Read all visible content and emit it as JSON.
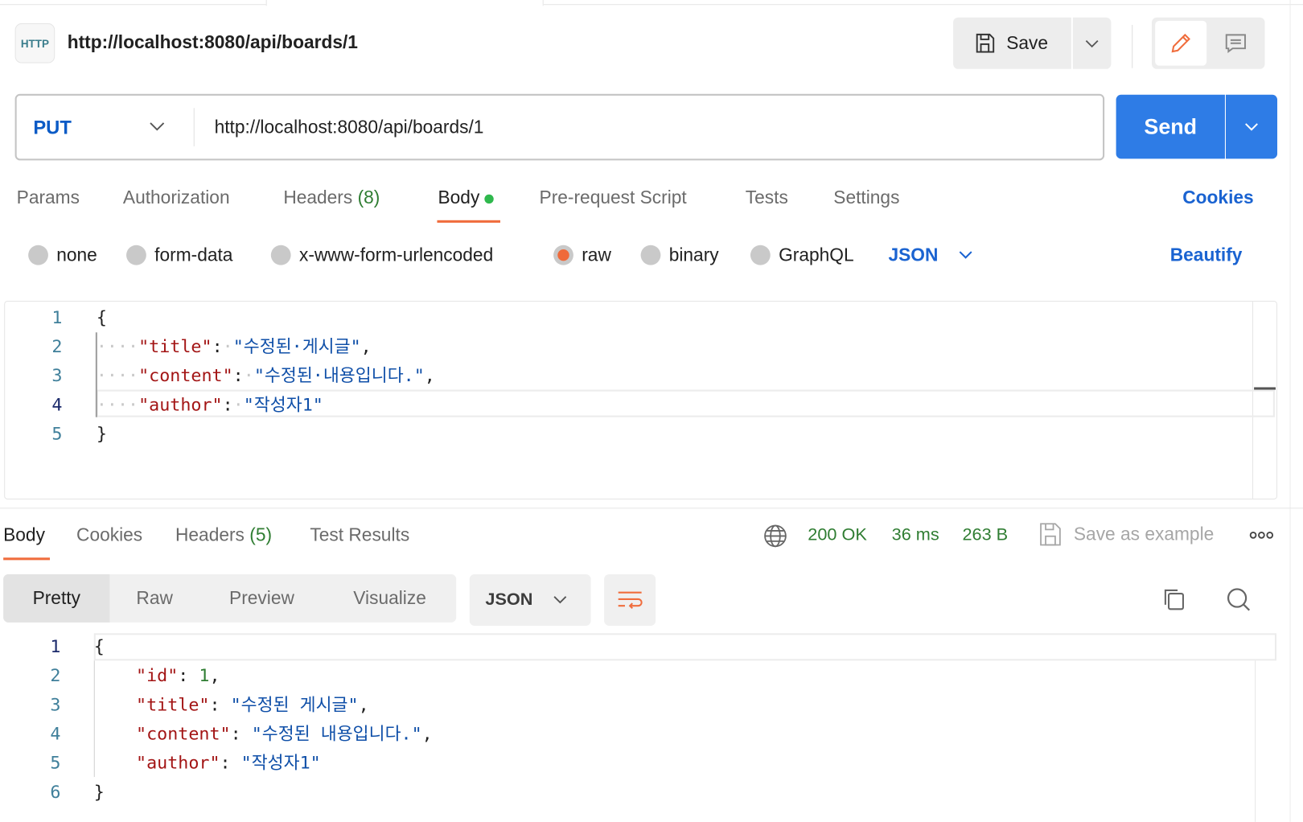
{
  "header": {
    "protocol_icon": "HTTP",
    "title": "http://localhost:8080/api/boards/1",
    "save_label": "Save"
  },
  "request": {
    "method": "PUT",
    "url": "http://localhost:8080/api/boards/1",
    "send_label": "Send"
  },
  "request_tabs": [
    {
      "label": "Params"
    },
    {
      "label": "Authorization"
    },
    {
      "label": "Headers",
      "count": "(8)"
    },
    {
      "label": "Body",
      "active": true
    },
    {
      "label": "Pre-request Script"
    },
    {
      "label": "Tests"
    },
    {
      "label": "Settings"
    }
  ],
  "cookies_link": "Cookies",
  "body_types": [
    {
      "label": "none"
    },
    {
      "label": "form-data"
    },
    {
      "label": "x-www-form-urlencoded"
    },
    {
      "label": "raw",
      "selected": true
    },
    {
      "label": "binary"
    },
    {
      "label": "GraphQL"
    }
  ],
  "body_format": "JSON",
  "beautify_label": "Beautify",
  "request_body": [
    [
      [
        "p",
        "{"
      ]
    ],
    [
      [
        "ws",
        "····"
      ],
      [
        "k",
        "\"title\""
      ],
      [
        "p",
        ":"
      ],
      [
        "ws",
        "·"
      ],
      [
        "s",
        "\"수정된·게시글\""
      ],
      [
        "p",
        ","
      ]
    ],
    [
      [
        "ws",
        "····"
      ],
      [
        "k",
        "\"content\""
      ],
      [
        "p",
        ":"
      ],
      [
        "ws",
        "·"
      ],
      [
        "s",
        "\"수정된·내용입니다.\""
      ],
      [
        "p",
        ","
      ]
    ],
    [
      [
        "ws",
        "····"
      ],
      [
        "k",
        "\"author\""
      ],
      [
        "p",
        ":"
      ],
      [
        "ws",
        "·"
      ],
      [
        "s",
        "\"작성자1\""
      ]
    ],
    [
      [
        "p",
        "}"
      ]
    ]
  ],
  "response_tabs": [
    {
      "label": "Body",
      "active": true
    },
    {
      "label": "Cookies"
    },
    {
      "label": "Headers",
      "count": "(5)"
    },
    {
      "label": "Test Results"
    }
  ],
  "response_status": {
    "status": "200 OK",
    "time": "36 ms",
    "size": "263 B",
    "save_example": "Save as example",
    "status_color": "#2f7d32"
  },
  "view_modes": [
    {
      "label": "Pretty",
      "active": true
    },
    {
      "label": "Raw"
    },
    {
      "label": "Preview"
    },
    {
      "label": "Visualize"
    }
  ],
  "response_format": "JSON",
  "response_body": [
    [
      [
        "p",
        "{"
      ]
    ],
    [
      [
        "ws",
        "    "
      ],
      [
        "k",
        "\"id\""
      ],
      [
        "p",
        ": "
      ],
      [
        "n",
        "1"
      ],
      [
        "p",
        ","
      ]
    ],
    [
      [
        "ws",
        "    "
      ],
      [
        "k",
        "\"title\""
      ],
      [
        "p",
        ": "
      ],
      [
        "s",
        "\"수정된 게시글\""
      ],
      [
        "p",
        ","
      ]
    ],
    [
      [
        "ws",
        "    "
      ],
      [
        "k",
        "\"content\""
      ],
      [
        "p",
        ": "
      ],
      [
        "s",
        "\"수정된 내용입니다.\""
      ],
      [
        "p",
        ","
      ]
    ],
    [
      [
        "ws",
        "    "
      ],
      [
        "k",
        "\"author\""
      ],
      [
        "p",
        ": "
      ],
      [
        "s",
        "\"작성자1\""
      ]
    ],
    [
      [
        "p",
        "}"
      ]
    ]
  ],
  "colors": {
    "accent": "#f06d3d",
    "send": "#2e7ce6",
    "method": "#0b5bc6",
    "link": "#1a63d1"
  }
}
